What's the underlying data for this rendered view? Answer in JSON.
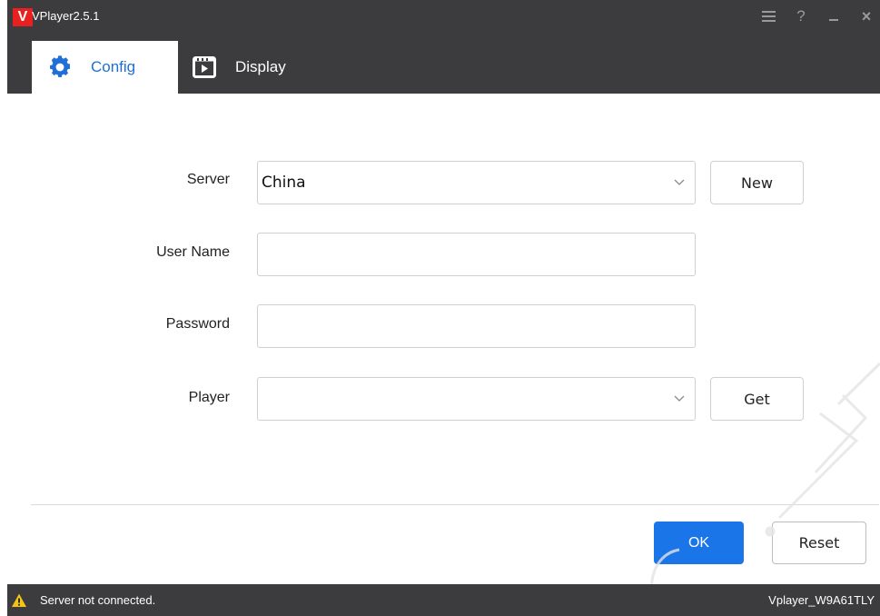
{
  "window": {
    "title": "VPlayer2.5.1",
    "logo_letter": "V",
    "accent_color": "#1a75e8",
    "brand_color": "#e8201f",
    "controls": {
      "menu": "menu-icon",
      "help": "?",
      "minimize": "minimize-icon",
      "close": "×"
    }
  },
  "tabs": [
    {
      "label": "Config",
      "icon": "gear-icon",
      "active": true
    },
    {
      "label": "Display",
      "icon": "display-icon",
      "active": false
    }
  ],
  "form": {
    "server": {
      "label": "Server",
      "value": "China",
      "new_button": "New"
    },
    "username": {
      "label": "User Name",
      "value": ""
    },
    "password": {
      "label": "Password",
      "value": ""
    },
    "player": {
      "label": "Player",
      "value": "",
      "get_button": "Get"
    }
  },
  "actions": {
    "ok": "OK",
    "reset": "Reset"
  },
  "status": {
    "message": "Server not connected.",
    "device": "Vplayer_W9A61TLY",
    "warning_color": "#f2c318"
  }
}
